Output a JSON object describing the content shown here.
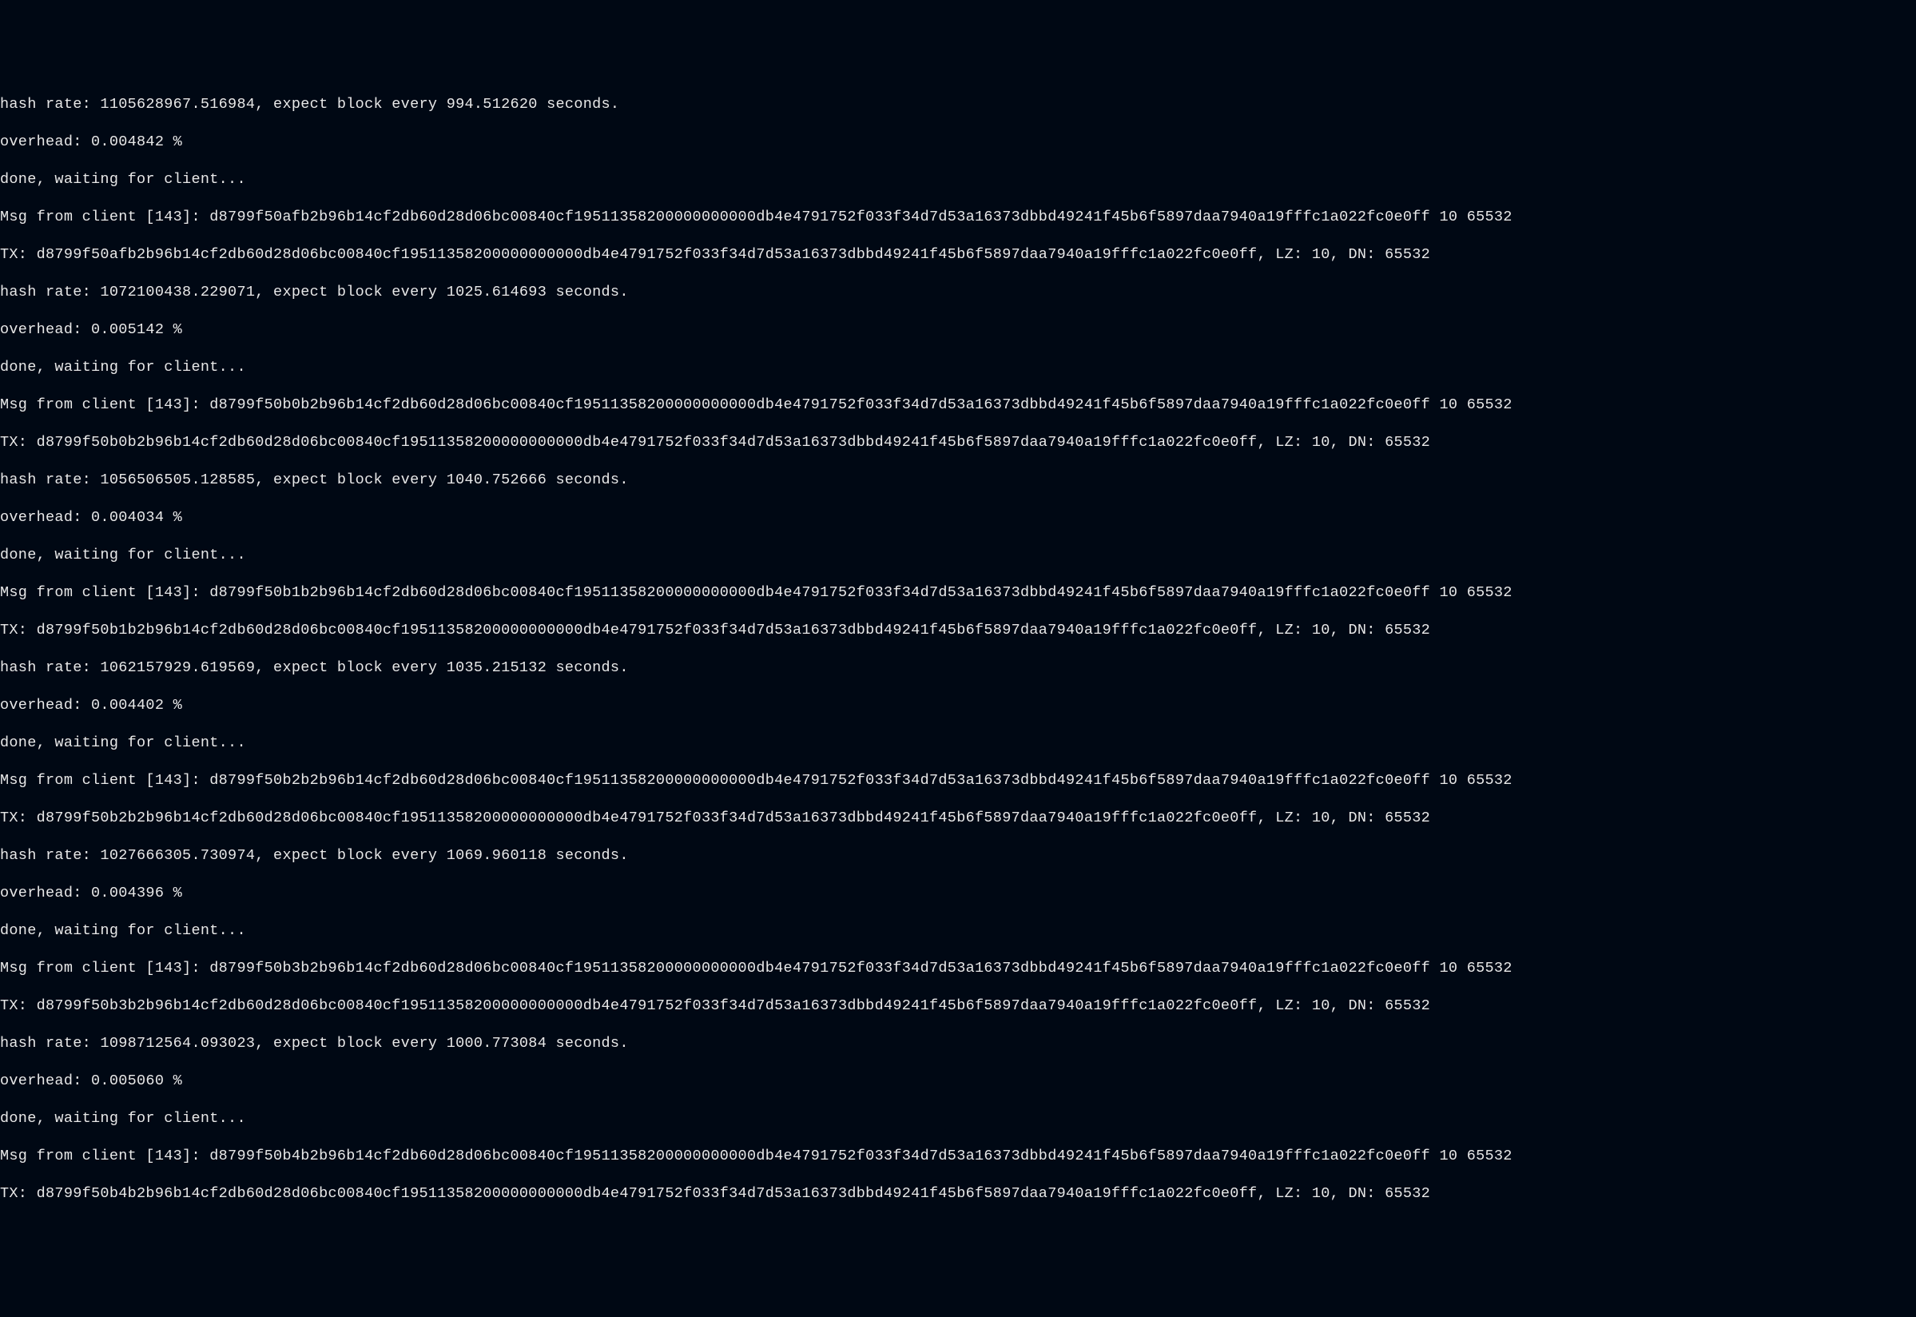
{
  "terminal": {
    "lines": [
      "hash rate: 1105628967.516984, expect block every 994.512620 seconds.",
      "overhead: 0.004842 %",
      "done, waiting for client...",
      "Msg from client [143]: d8799f50afb2b96b14cf2db60d28d06bc00840cf19511358200000000000db4e4791752f033f34d7d53a16373dbbd49241f45b6f5897daa7940a19fffc1a022fc0e0ff 10 65532",
      "TX: d8799f50afb2b96b14cf2db60d28d06bc00840cf19511358200000000000db4e4791752f033f34d7d53a16373dbbd49241f45b6f5897daa7940a19fffc1a022fc0e0ff, LZ: 10, DN: 65532",
      "hash rate: 1072100438.229071, expect block every 1025.614693 seconds.",
      "overhead: 0.005142 %",
      "done, waiting for client...",
      "Msg from client [143]: d8799f50b0b2b96b14cf2db60d28d06bc00840cf19511358200000000000db4e4791752f033f34d7d53a16373dbbd49241f45b6f5897daa7940a19fffc1a022fc0e0ff 10 65532",
      "TX: d8799f50b0b2b96b14cf2db60d28d06bc00840cf19511358200000000000db4e4791752f033f34d7d53a16373dbbd49241f45b6f5897daa7940a19fffc1a022fc0e0ff, LZ: 10, DN: 65532",
      "hash rate: 1056506505.128585, expect block every 1040.752666 seconds.",
      "overhead: 0.004034 %",
      "done, waiting for client...",
      "Msg from client [143]: d8799f50b1b2b96b14cf2db60d28d06bc00840cf19511358200000000000db4e4791752f033f34d7d53a16373dbbd49241f45b6f5897daa7940a19fffc1a022fc0e0ff 10 65532",
      "TX: d8799f50b1b2b96b14cf2db60d28d06bc00840cf19511358200000000000db4e4791752f033f34d7d53a16373dbbd49241f45b6f5897daa7940a19fffc1a022fc0e0ff, LZ: 10, DN: 65532",
      "hash rate: 1062157929.619569, expect block every 1035.215132 seconds.",
      "overhead: 0.004402 %",
      "done, waiting for client...",
      "Msg from client [143]: d8799f50b2b2b96b14cf2db60d28d06bc00840cf19511358200000000000db4e4791752f033f34d7d53a16373dbbd49241f45b6f5897daa7940a19fffc1a022fc0e0ff 10 65532",
      "TX: d8799f50b2b2b96b14cf2db60d28d06bc00840cf19511358200000000000db4e4791752f033f34d7d53a16373dbbd49241f45b6f5897daa7940a19fffc1a022fc0e0ff, LZ: 10, DN: 65532",
      "hash rate: 1027666305.730974, expect block every 1069.960118 seconds.",
      "overhead: 0.004396 %",
      "done, waiting for client...",
      "Msg from client [143]: d8799f50b3b2b96b14cf2db60d28d06bc00840cf19511358200000000000db4e4791752f033f34d7d53a16373dbbd49241f45b6f5897daa7940a19fffc1a022fc0e0ff 10 65532",
      "TX: d8799f50b3b2b96b14cf2db60d28d06bc00840cf19511358200000000000db4e4791752f033f34d7d53a16373dbbd49241f45b6f5897daa7940a19fffc1a022fc0e0ff, LZ: 10, DN: 65532",
      "hash rate: 1098712564.093023, expect block every 1000.773084 seconds.",
      "overhead: 0.005060 %",
      "done, waiting for client...",
      "Msg from client [143]: d8799f50b4b2b96b14cf2db60d28d06bc00840cf19511358200000000000db4e4791752f033f34d7d53a16373dbbd49241f45b6f5897daa7940a19fffc1a022fc0e0ff 10 65532",
      "TX: d8799f50b4b2b96b14cf2db60d28d06bc00840cf19511358200000000000db4e4791752f033f34d7d53a16373dbbd49241f45b6f5897daa7940a19fffc1a022fc0e0ff, LZ: 10, DN: 65532"
    ]
  }
}
